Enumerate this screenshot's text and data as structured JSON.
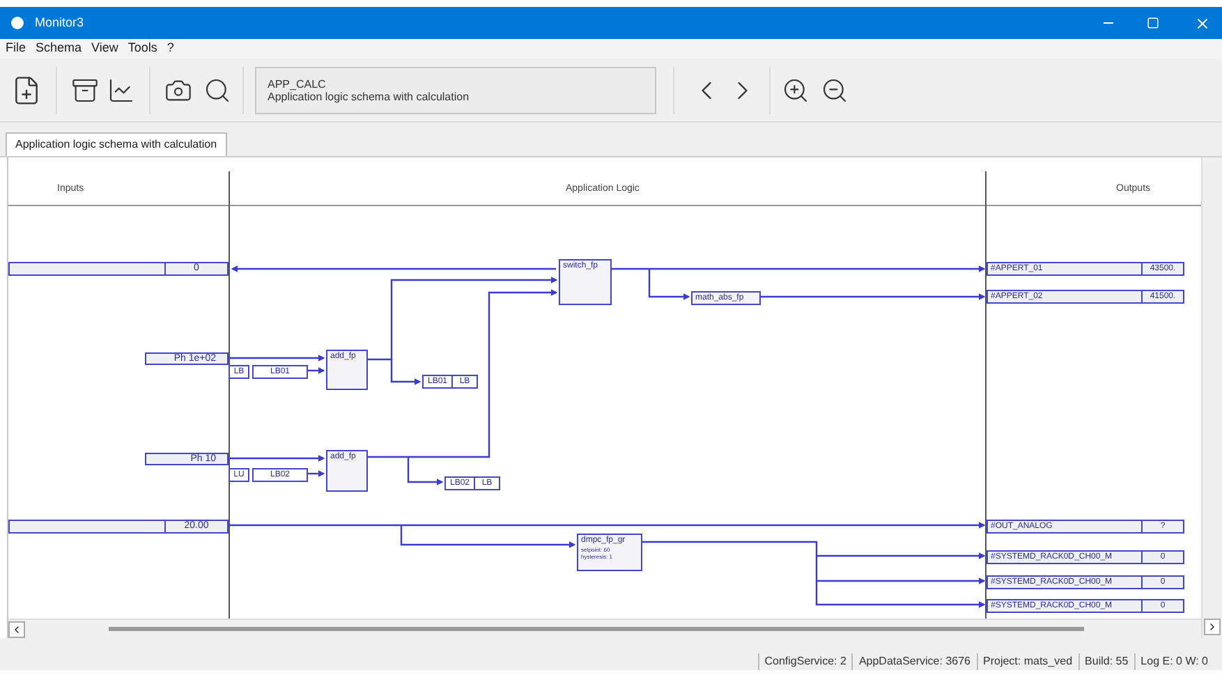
{
  "window": {
    "title": "Monitor3"
  },
  "menu": [
    "File",
    "Schema",
    "View",
    "Tools",
    "?"
  ],
  "toolbar": {
    "schema_id": "APP_CALC",
    "schema_caption": "Application logic schema with calculation"
  },
  "tabs": [
    {
      "label": "Application logic schema with calculation",
      "selected": true
    }
  ],
  "schema": {
    "headers": [
      "Inputs",
      "Application Logic",
      "Outputs"
    ],
    "inputs": [
      {
        "kind": "signal",
        "value": "0"
      },
      {
        "kind": "constant",
        "value": "Ph 1e+02"
      },
      {
        "kind": "constant",
        "value": "Ph 10"
      },
      {
        "kind": "signal",
        "value": "20.00"
      }
    ],
    "input_vars": [
      {
        "tag": "LB",
        "name": "LB01"
      },
      {
        "tag": "LU",
        "name": "LB02"
      }
    ],
    "output_vars": [
      {
        "name": "LB01",
        "tag": "LB"
      },
      {
        "name": "LB02",
        "tag": "LB"
      }
    ],
    "blocks": [
      {
        "name": "switch_fp"
      },
      {
        "name": "add_fp"
      },
      {
        "name": "add_fp"
      },
      {
        "name": "math_abs_fp"
      },
      {
        "name": "dmpc_fp_gr",
        "params": [
          "setpoint: 60",
          "hysteresis: 1"
        ]
      }
    ],
    "outputs": [
      {
        "name": "#APPERT_01",
        "value": "43500."
      },
      {
        "name": "#APPERT_02",
        "value": "41500."
      },
      {
        "name": "#OUT_ANALOG",
        "value": "?"
      },
      {
        "name": "#SYSTEMD_RACK0D_CH00_M",
        "value": "0"
      },
      {
        "name": "#SYSTEMD_RACK0D_CH00_M",
        "value": "0"
      },
      {
        "name": "#SYSTEMD_RACK0D_CH00_M",
        "value": "0"
      }
    ]
  },
  "status_bar": [
    "ConfigService: 2",
    "AppDataService: 3676",
    "Project: mats_ved",
    "Build: 55",
    "Log E: 0 W: 0"
  ]
}
